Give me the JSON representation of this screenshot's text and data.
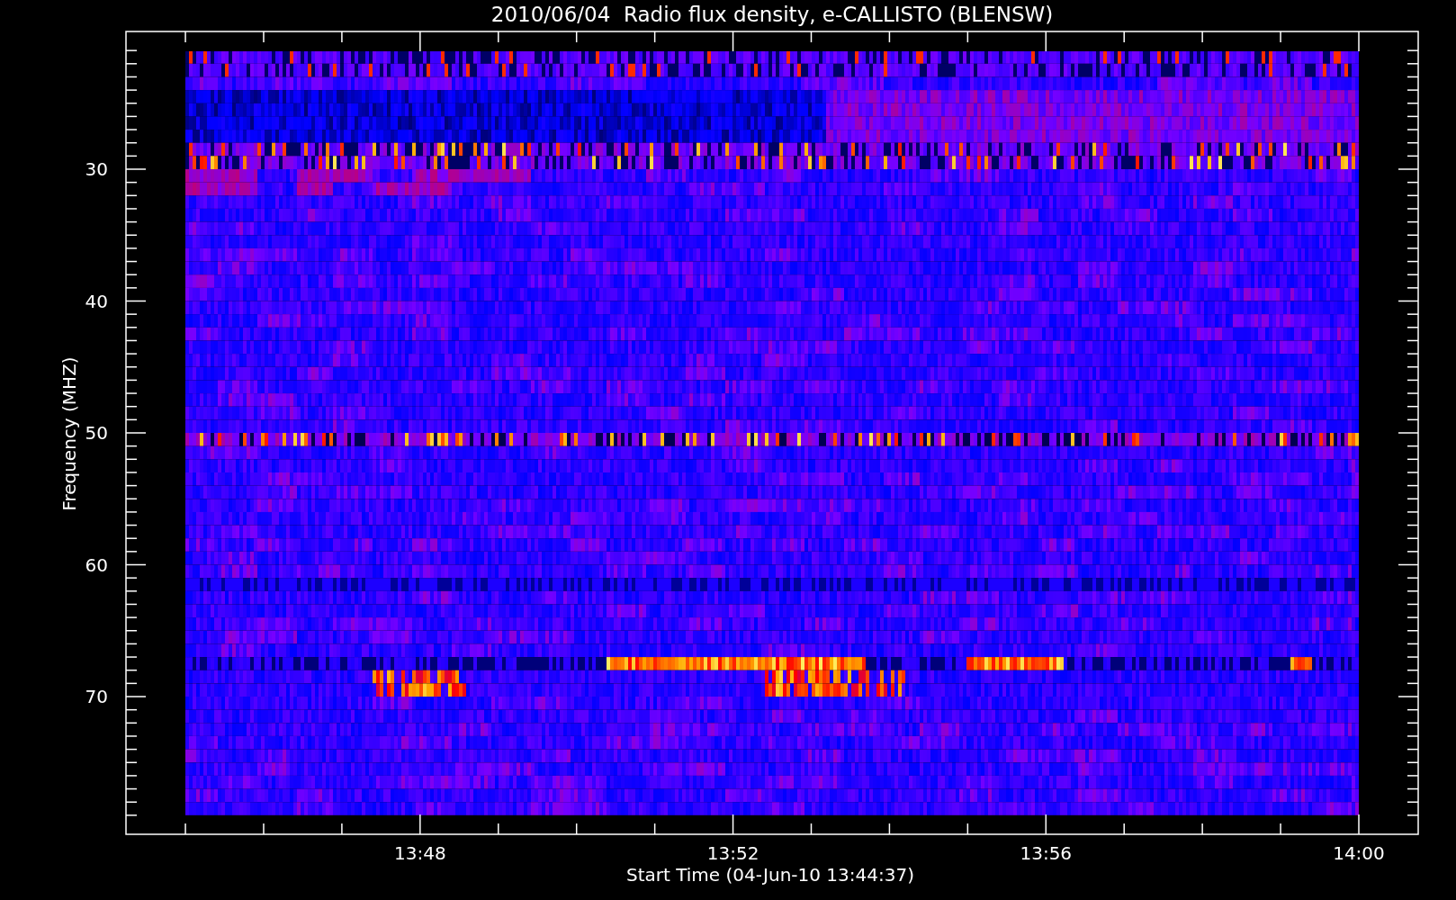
{
  "title": "2010/06/04  Radio flux density, e-CALLISTO (BLENSW)",
  "xlabel": "Start Time (04-Jun-10 13:44:37)",
  "ylabel": "Frequency (MHZ)",
  "xticks": [
    "13:48",
    "13:52",
    "13:56",
    "14:00"
  ],
  "yticks": [
    "30",
    "40",
    "50",
    "60",
    "70"
  ]
}
